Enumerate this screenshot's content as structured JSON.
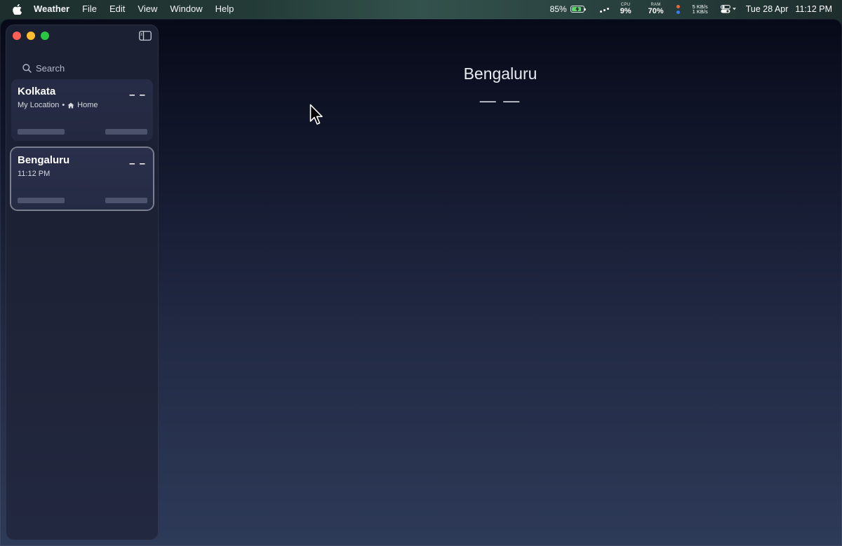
{
  "menubar": {
    "app_name": "Weather",
    "menus": [
      "File",
      "Edit",
      "View",
      "Window",
      "Help"
    ],
    "battery_percent_label": "85%",
    "battery_level": 0.85,
    "cpu_label": "CPU",
    "cpu_value": "9%",
    "ram_label": "RAM",
    "ram_value": "70%",
    "net_up": "5 KB/s",
    "net_down": "1 KB/s",
    "date": "Tue 28 Apr",
    "time": "11:12 PM"
  },
  "sidebar": {
    "search_placeholder": "Search",
    "locations": [
      {
        "city": "Kolkata",
        "subtitle": "My Location",
        "separator": "•",
        "tag": "Home",
        "temperature": "– –"
      },
      {
        "city": "Bengaluru",
        "subtitle": "11:12 PM",
        "temperature": "– –"
      }
    ]
  },
  "main": {
    "city": "Bengaluru",
    "temperature": "— —"
  },
  "colors": {
    "close": "#ff5f57",
    "minimize": "#febc2e",
    "maximize": "#28c840",
    "battery_fill": "#5fd76a"
  }
}
